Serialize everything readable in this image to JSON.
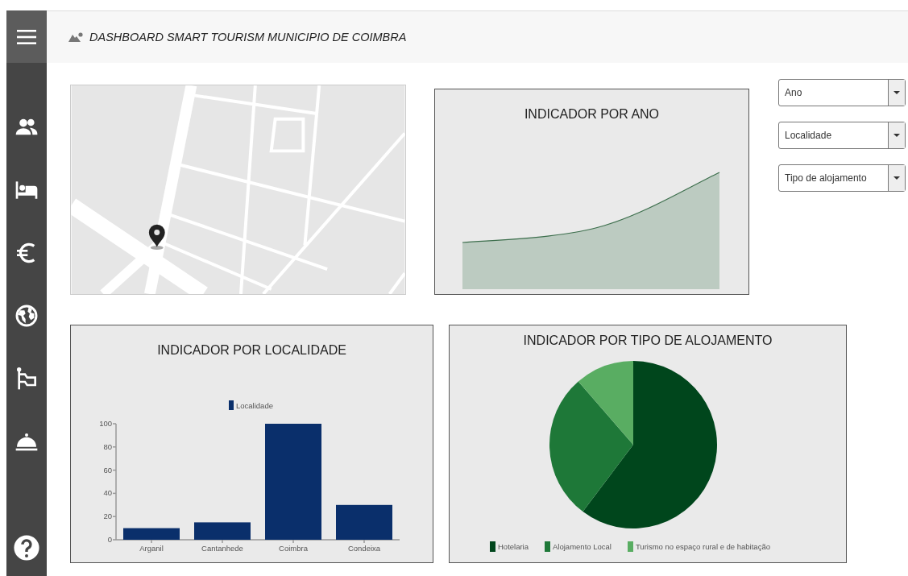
{
  "header": {
    "title": "DASHBOARD SMART TOURISM MUNICIPIO DE COIMBRA"
  },
  "area_chart": {
    "title": "INDICADOR POR ANO"
  },
  "filters": [
    {
      "placeholder": "Ano"
    },
    {
      "placeholder": "Localidade"
    },
    {
      "placeholder": "Tipo de alojamento"
    }
  ],
  "bar_chart": {
    "chart_data": {
      "type": "bar",
      "title": "INDICADOR POR LOCALIDADE",
      "categories": [
        "Arganil",
        "Cantanhede",
        "Coimbra",
        "Condeixa"
      ],
      "series": [
        {
          "name": "Localidade",
          "color": "#0a2f6b",
          "values": [
            10,
            15,
            100,
            30
          ]
        }
      ],
      "ylim": [
        0,
        100
      ],
      "yticks": [
        0,
        20,
        40,
        60,
        80,
        100
      ]
    }
  },
  "pie_chart": {
    "title": "INDICADOR POR TIPO DE ALOJAMENTO",
    "legend": [
      {
        "label": "Hotelaria",
        "color": "#00461c"
      },
      {
        "label": "Alojamento Local",
        "color": "#1e7838"
      },
      {
        "label": "Turismo no espaço rural e de habitação",
        "color": "#59ad62"
      }
    ]
  }
}
